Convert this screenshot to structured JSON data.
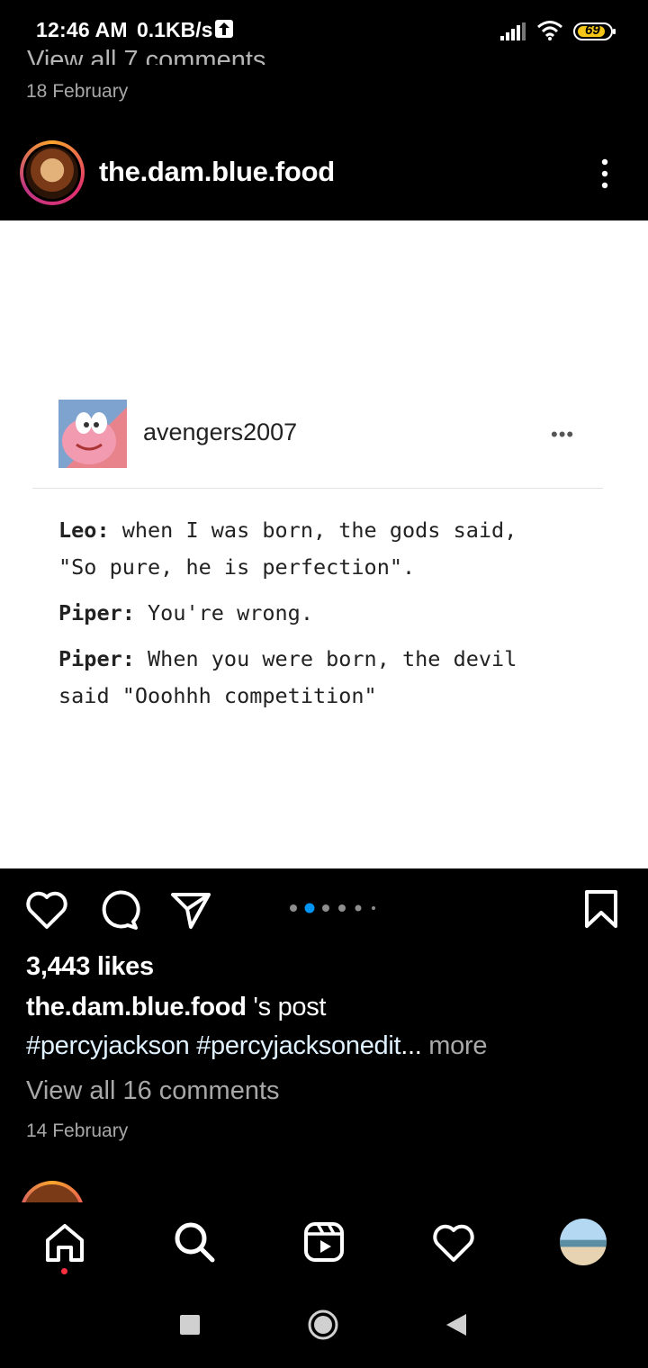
{
  "status_bar": {
    "time": "12:46 AM",
    "speed": "0.1KB/s",
    "battery": "69"
  },
  "previous_post": {
    "view_comments": "View all 7 comments",
    "date": "18 February"
  },
  "post": {
    "username": "the.dam.blue.food",
    "image": {
      "tumblr_username": "avengers2007",
      "dialogue": [
        {
          "speaker": "Leo:",
          "line1": " when I was born, the gods said,",
          "line2": "\"So pure, he is perfection\"."
        },
        {
          "speaker": "Piper:",
          "line1": " You're wrong.",
          "line2": ""
        },
        {
          "speaker": "Piper:",
          "line1": " When you were born, the devil",
          "line2": "said \"Ooohhh competition\""
        }
      ]
    },
    "carousel": {
      "count": 6,
      "active_index": 1
    },
    "likes": "3,443 likes",
    "caption_user": "the.dam.blue.food",
    "caption_suffix": " 's post",
    "hashtags": "#percyjackson #percyjacksonedit",
    "ellipsis": "...",
    "more": " more",
    "view_comments": "View all 16 comments",
    "date": "14 February"
  },
  "colors": {
    "background": "#000000",
    "secondary_text": "#a8a8a8",
    "carousel_active": "#0095f6",
    "notification_dot": "#ff3040"
  },
  "icons": [
    "upload-icon",
    "signal-icon",
    "wifi-icon",
    "battery-icon",
    "more-icon",
    "heart-icon",
    "comment-icon",
    "share-icon",
    "bookmark-icon",
    "home-icon",
    "search-icon",
    "reels-icon",
    "activity-icon"
  ]
}
